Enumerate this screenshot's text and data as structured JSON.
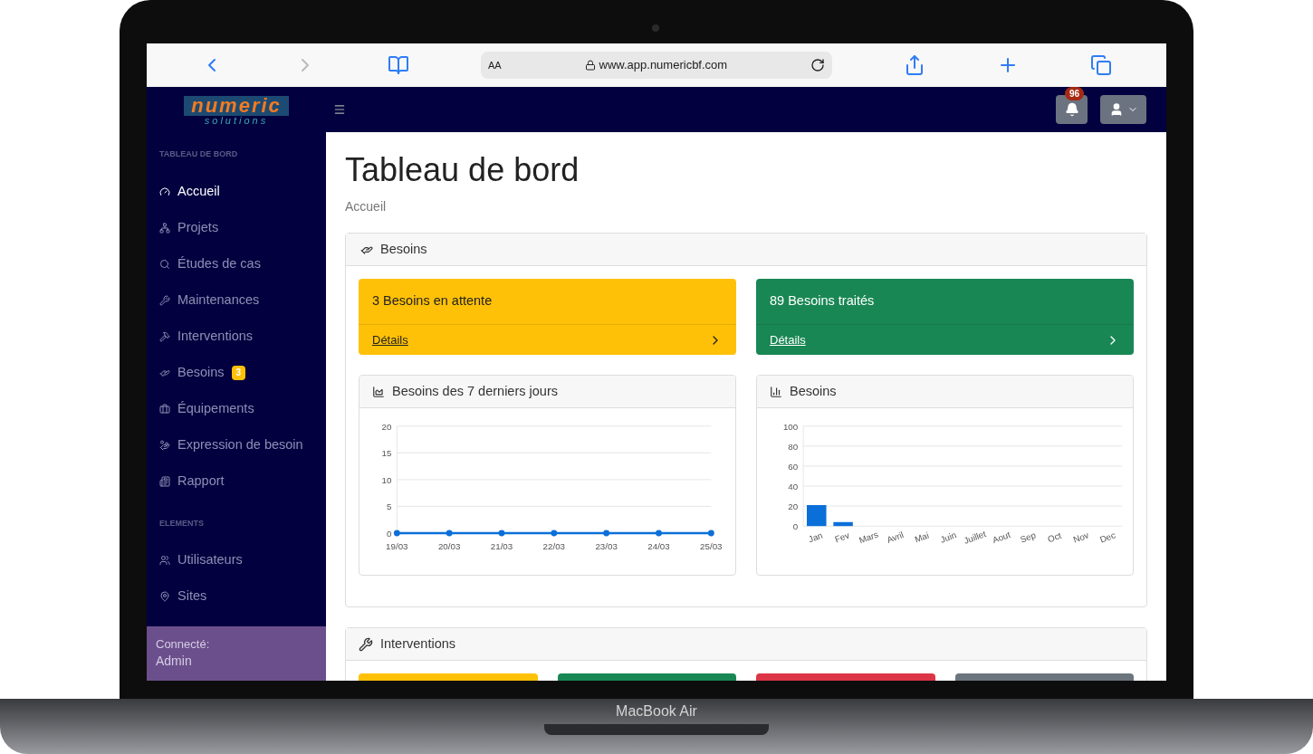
{
  "browser": {
    "text_size": "AA",
    "url": "www.app.numericbf.com"
  },
  "logo": {
    "line1": "numeric",
    "line2": "solutions"
  },
  "sidebar": {
    "sections": [
      {
        "title": "TABLEAU DE BORD",
        "items": [
          {
            "label": "Accueil",
            "selected": true
          },
          {
            "label": "Projets",
            "selected": false
          },
          {
            "label": "Études de cas",
            "selected": false
          },
          {
            "label": "Maintenances",
            "selected": false
          },
          {
            "label": "Interventions",
            "selected": false
          },
          {
            "label": "Besoins",
            "selected": false,
            "badge": "3"
          },
          {
            "label": "Équipements",
            "selected": false
          },
          {
            "label": "Expression de besoin",
            "selected": false
          },
          {
            "label": "Rapport",
            "selected": false
          }
        ]
      },
      {
        "title": "ELEMENTS",
        "items": [
          {
            "label": "Utilisateurs",
            "selected": false
          },
          {
            "label": "Sites",
            "selected": false
          }
        ]
      }
    ],
    "footer": {
      "label": "Connecté:",
      "user": "Admin"
    }
  },
  "topbar": {
    "notifications": "96"
  },
  "page": {
    "title": "Tableau de bord",
    "breadcrumb": "Accueil"
  },
  "besoins": {
    "title": "Besoins",
    "stats": [
      {
        "text": "3 Besoins en attente",
        "link": "Détails",
        "color": "#ffc107"
      },
      {
        "text": "89 Besoins traités",
        "link": "Détails",
        "color": "#198754"
      }
    ],
    "charts": [
      {
        "title": "Besoins des 7 derniers jours",
        "chart_data": {
          "type": "line",
          "categories": [
            "19/03",
            "20/03",
            "21/03",
            "22/03",
            "23/03",
            "24/03",
            "25/03"
          ],
          "grid": true,
          "series": [
            {
              "color": "#0b6fd9",
              "marker": true,
              "values": [
                0,
                0,
                0,
                0,
                0,
                0,
                0
              ]
            }
          ],
          "ylim": [
            0,
            20
          ],
          "yticks": [
            0,
            5,
            10,
            15,
            20
          ]
        }
      },
      {
        "title": "Besoins",
        "chart_data": {
          "type": "bar",
          "categories": [
            "Jan",
            "Fev",
            "Mars",
            "Avril",
            "Mai",
            "Juin",
            "Juillet",
            "Aout",
            "Sep",
            "Oct",
            "Nov",
            "Dec"
          ],
          "grid": true,
          "series": [
            {
              "color": "#0b6fd9",
              "values": [
                21,
                4,
                0,
                0,
                0,
                0,
                0,
                0,
                0,
                0,
                0,
                0
              ]
            }
          ],
          "ylim": [
            0,
            100
          ],
          "yticks": [
            0,
            20,
            40,
            60,
            80,
            100
          ]
        }
      }
    ]
  },
  "interventions": {
    "title": "Interventions",
    "cards": [
      {
        "color": "#ffc107"
      },
      {
        "color": "#198754"
      },
      {
        "color": "#dc3545"
      },
      {
        "color": "#6c757d"
      }
    ]
  },
  "device": {
    "label": "MacBook Air"
  }
}
